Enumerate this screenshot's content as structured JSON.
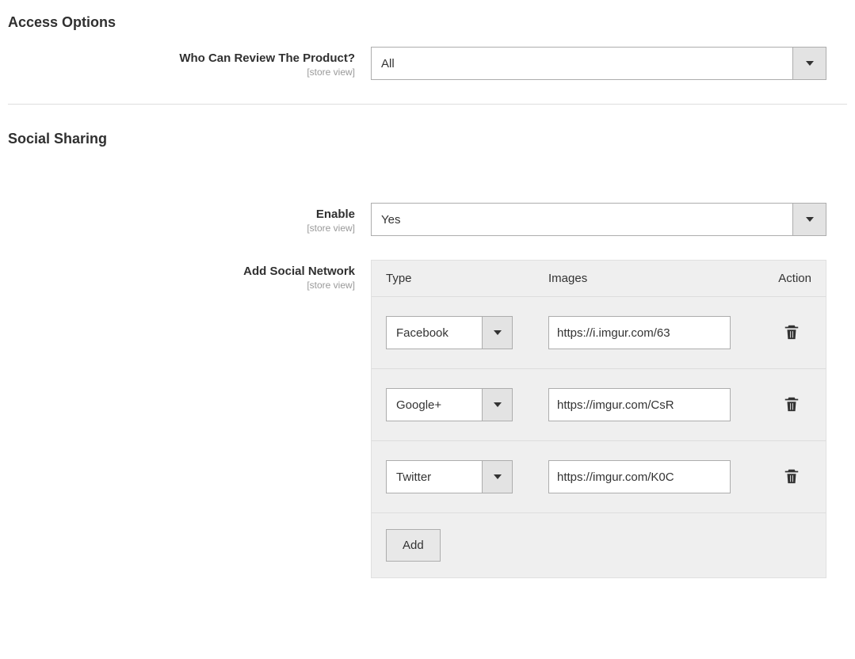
{
  "access_options": {
    "title": "Access Options",
    "review_label": "Who Can Review The Product?",
    "review_scope": "[store view]",
    "review_value": "All"
  },
  "social_sharing": {
    "title": "Social Sharing",
    "enable_label": "Enable",
    "enable_scope": "[store view]",
    "enable_value": "Yes",
    "add_network_label": "Add Social Network",
    "add_network_scope": "[store view]",
    "columns": {
      "type": "Type",
      "images": "Images",
      "action": "Action"
    },
    "rows": [
      {
        "type": "Facebook",
        "image": "https://i.imgur.com/63"
      },
      {
        "type": "Google+",
        "image": "https://imgur.com/CsR"
      },
      {
        "type": "Twitter",
        "image": "https://imgur.com/K0C"
      }
    ],
    "add_button": "Add"
  }
}
